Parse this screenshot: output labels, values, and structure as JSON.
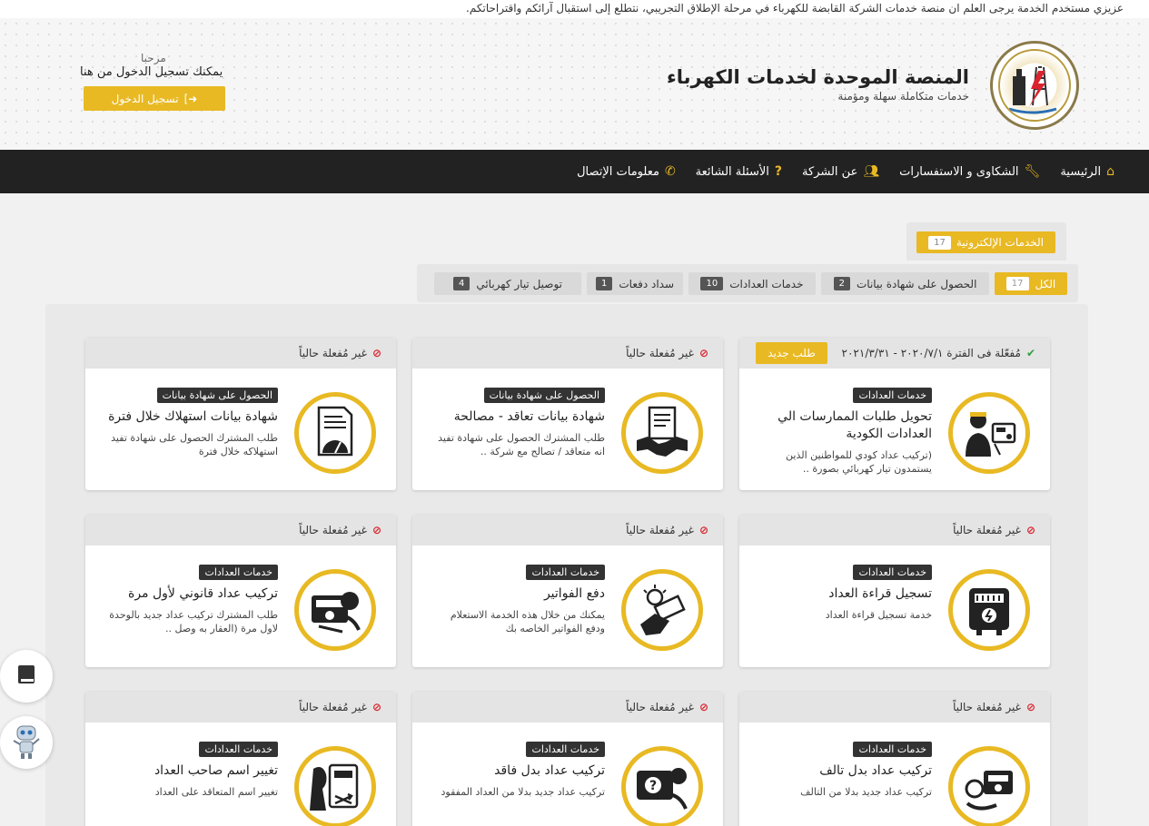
{
  "ticker": "عزيزي مستخدم الخدمة يرجى العلم ان منصة خدمات الشركة القابضة للكهرباء في مرحلة الإطلاق التجريبي، نتطلع إلى استقبال آرائكم واقتراحاتكم.",
  "header": {
    "title": "المنصة الموحدة لخدمات الكهرباء",
    "subtitle": "خدمات متكاملة سهلة ومؤمنة",
    "welcome": "مرحبا",
    "login_hint": "يمكنك تسجيل الدخول من هنا",
    "login_button": "تسجيل الدخول"
  },
  "nav": [
    {
      "label": "الرئيسية",
      "icon": "home-icon"
    },
    {
      "label": "الشكاوى و الاستفسارات",
      "icon": "wrench-icon"
    },
    {
      "label": "عن الشركة",
      "icon": "users-icon"
    },
    {
      "label": "الأسئلة الشائعة",
      "icon": "question-icon"
    },
    {
      "label": "معلومات الإتصال",
      "icon": "phone-icon"
    }
  ],
  "eservices": {
    "label": "الخدمات الإلكترونية",
    "count": "17"
  },
  "tabs": [
    {
      "label": "الكل",
      "count": "17",
      "active": true
    },
    {
      "label": "الحصول على شهادة بيانات",
      "count": "2"
    },
    {
      "label": "خدمات العدادات",
      "count": "10"
    },
    {
      "label": "سداد دفعات",
      "count": "1"
    },
    {
      "label": "توصيل تيار كهربائي",
      "count": "4"
    }
  ],
  "cards": [
    {
      "status": "مُفعّلة فى الفترة ٢٠٢٠/٧/١ - ٢٠٢١/٣/٣١",
      "active": true,
      "request_label": "طلب جديد",
      "category": "خدمات العدادات",
      "title": "تحويل طلبات الممارسات الي العدادات الكودية",
      "desc": "(تركيب عداد كودي للمواطنين الذين يستمدون تيار كهربائي بصورة ..",
      "icon": "worker-meter-icon"
    },
    {
      "status": "غير مُفعلة حالياً",
      "category": "الحصول على شهادة بيانات",
      "title": "شهادة بيانات تعاقد - مصالحة",
      "desc": "طلب المشترك الحصول على شهادة تفيد انه متعاقد / تصالح مع شركة ..",
      "icon": "contract-handshake-icon"
    },
    {
      "status": "غير مُفعلة حالياً",
      "category": "الحصول على شهادة بيانات",
      "title": "شهادة بيانات استهلاك خلال فترة",
      "desc": "طلب المشترك الحصول على شهادة تفيد استهلاكه خلال فترة",
      "icon": "consumption-gauge-icon"
    },
    {
      "status": "غير مُفعلة حالياً",
      "category": "خدمات العدادات",
      "title": "تسجيل قراءة العداد",
      "desc": "خدمة تسجيل قراءة العداد",
      "icon": "meter-reading-icon"
    },
    {
      "status": "غير مُفعلة حالياً",
      "category": "خدمات العدادات",
      "title": "دفع الفواتير",
      "desc": "يمكنك من خلال هذه الخدمة الاستعلام ودفع الفواتير الخاصه بك",
      "icon": "bill-payment-icon"
    },
    {
      "status": "غير مُفعلة حالياً",
      "category": "خدمات العدادات",
      "title": "تركيب عداد قانوني لأول مرة",
      "desc": "طلب المشترك تركيب عداد جديد بالوحدة لاول مرة (العقار به وصل ..",
      "icon": "meter-install-icon"
    },
    {
      "status": "غير مُفعلة حالياً",
      "category": "خدمات العدادات",
      "title": "تركيب عداد بدل تالف",
      "desc": "تركيب عداد جديد بدلا من التالف",
      "icon": "damaged-meter-icon"
    },
    {
      "status": "غير مُفعلة حالياً",
      "category": "خدمات العدادات",
      "title": "تركيب عداد بدل فاقد",
      "desc": "تركيب عداد جديد بدلا من العداد المفقود",
      "icon": "lost-meter-icon"
    },
    {
      "status": "غير مُفعلة حالياً",
      "category": "خدمات العدادات",
      "title": "تغيير اسم صاحب العداد",
      "desc": "تغيير اسم المتعاقد على العداد",
      "icon": "change-owner-icon"
    }
  ],
  "colors": {
    "accent": "#e8b923",
    "nav_bg": "#222222",
    "active_status": "#2e9e3e",
    "inactive_status": "#d9232e"
  }
}
